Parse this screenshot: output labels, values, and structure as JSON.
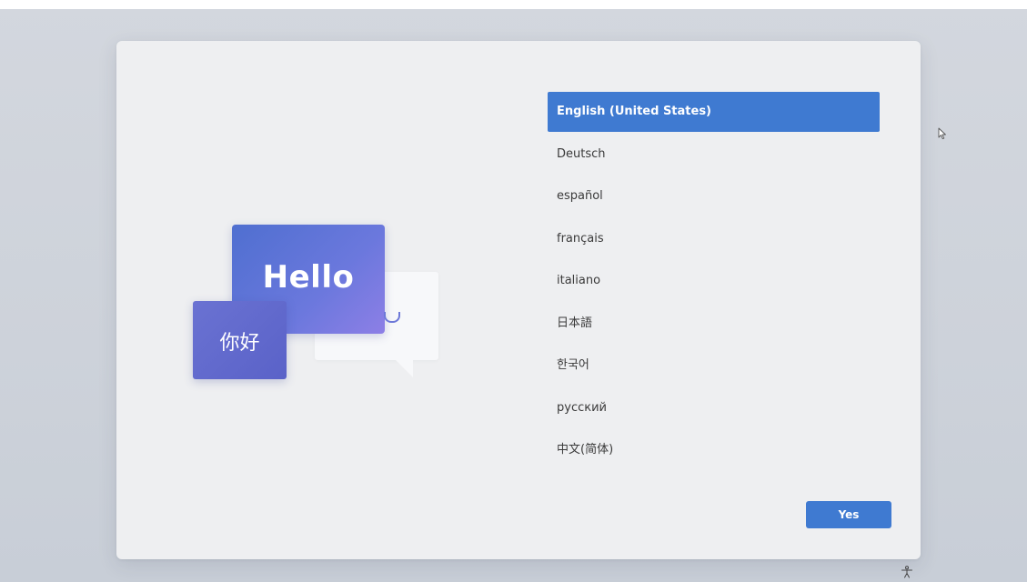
{
  "languages": [
    {
      "label": "English (United States)",
      "selected": true
    },
    {
      "label": "Deutsch",
      "selected": false
    },
    {
      "label": "español",
      "selected": false
    },
    {
      "label": "français",
      "selected": false
    },
    {
      "label": "italiano",
      "selected": false
    },
    {
      "label": "日本語",
      "selected": false
    },
    {
      "label": "한국어",
      "selected": false
    },
    {
      "label": "русский",
      "selected": false
    },
    {
      "label": "中文(简体)",
      "selected": false
    }
  ],
  "illustration": {
    "hello_text": "Hello",
    "nihao_text": "你好"
  },
  "actions": {
    "yes_label": "Yes"
  },
  "icons": {
    "pointer": "mouse-pointer-icon",
    "accessibility": "accessibility-icon"
  },
  "colors": {
    "accent": "#3f7ad1",
    "panel_bg": "#eeeff1",
    "desktop_bg": "#cfd4dc",
    "hello_card": "#5b6fd3",
    "nihao_card": "#6168cb"
  }
}
